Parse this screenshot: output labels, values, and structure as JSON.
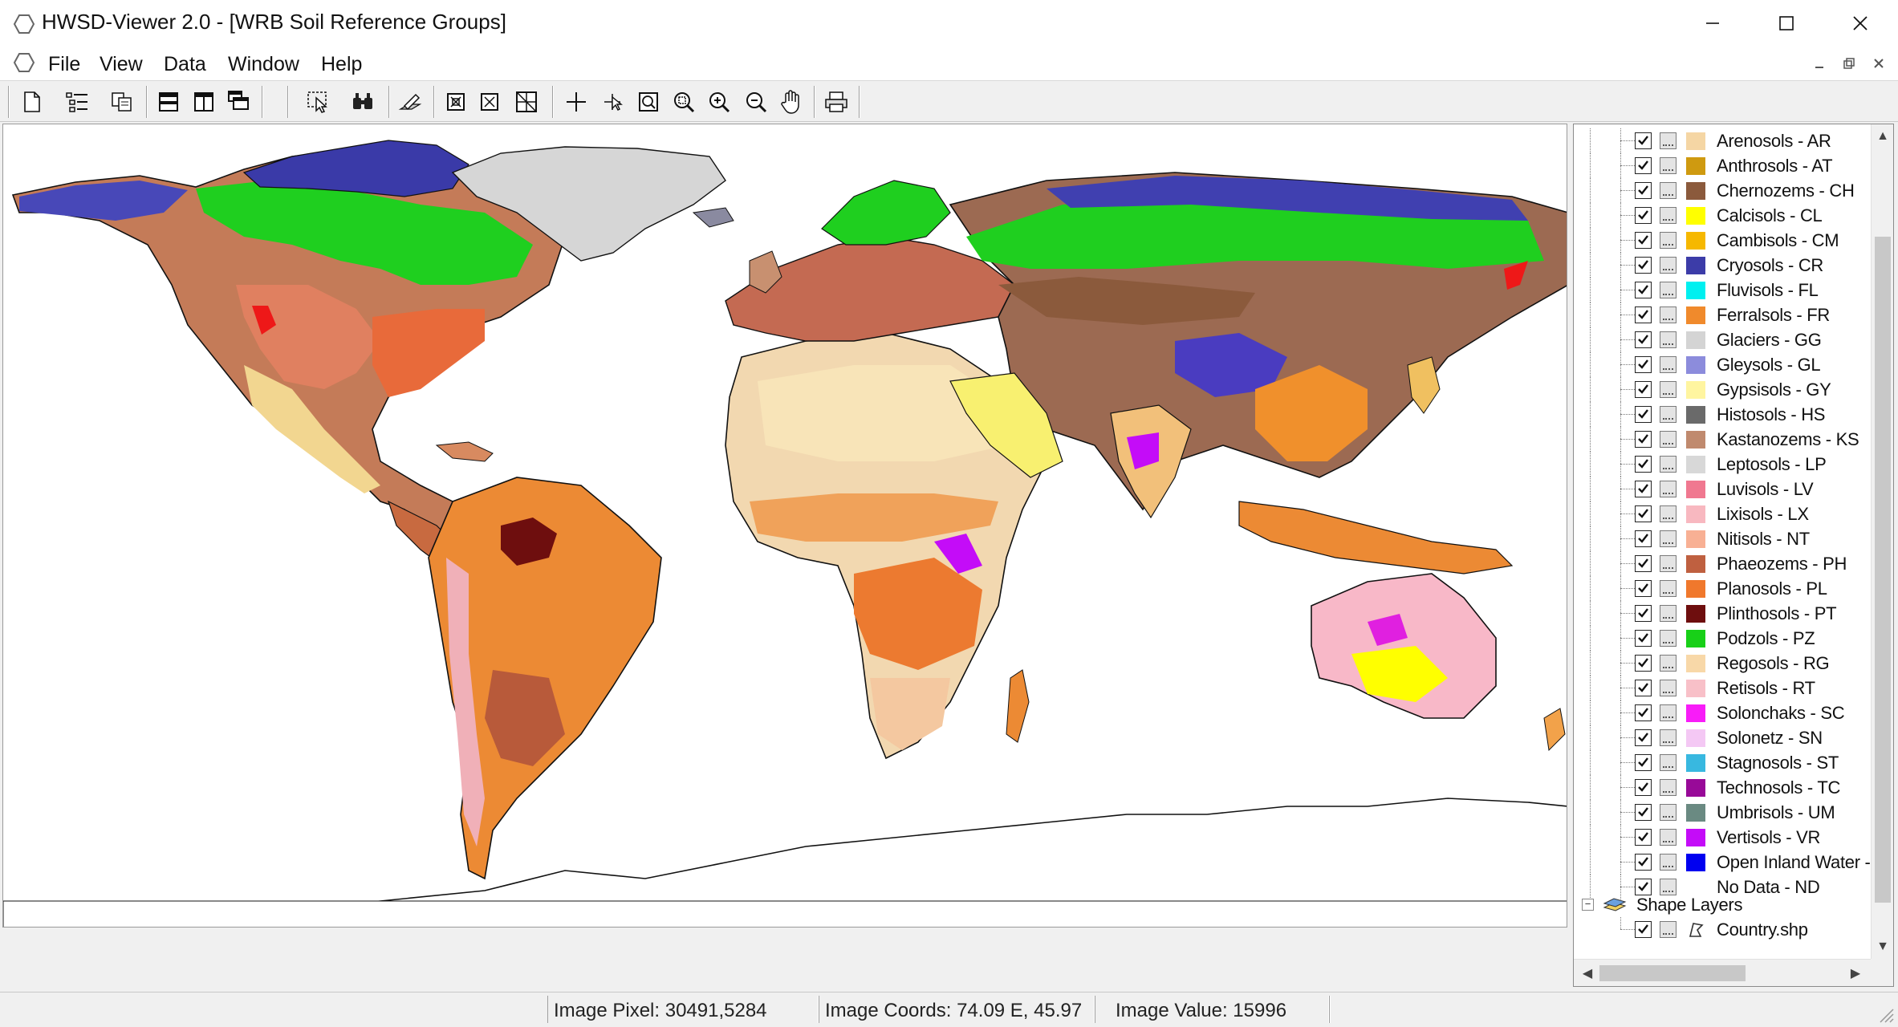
{
  "window": {
    "title": "HWSD-Viewer 2.0 - [WRB Soil Reference Groups]"
  },
  "menu": {
    "items": [
      "File",
      "View",
      "Data",
      "Window",
      "Help"
    ]
  },
  "toolbar": {
    "buttons": [
      "new-icon",
      "layer-list-icon",
      "copy-icon",
      "split-horizontal-icon",
      "split-vertical-icon",
      "cascade-icon",
      "select-icon",
      "identify-icon",
      "edit-icon",
      "zoom-box-icon",
      "zoom-prev-icon",
      "zoom-grid-icon",
      "crosshair-icon",
      "pointer-icon",
      "zoom-extent-icon",
      "zoom-region-icon",
      "zoom-in-icon",
      "zoom-out-icon",
      "pan-icon",
      "print-icon"
    ]
  },
  "legend": {
    "items": [
      {
        "label": "Arenosols - AR",
        "color": "#f5d6a4"
      },
      {
        "label": "Anthrosols - AT",
        "color": "#cf9a10"
      },
      {
        "label": "Chernozems - CH",
        "color": "#8b5a3c"
      },
      {
        "label": "Calcisols - CL",
        "color": "#ffff00"
      },
      {
        "label": "Cambisols - CM",
        "color": "#f6b800"
      },
      {
        "label": "Cryosols - CR",
        "color": "#3c3ca8"
      },
      {
        "label": "Fluvisols - FL",
        "color": "#00f0f0"
      },
      {
        "label": "Ferralsols - FR",
        "color": "#f08a2c"
      },
      {
        "label": "Glaciers - GG",
        "color": "#d4d4d4"
      },
      {
        "label": "Gleysols - GL",
        "color": "#8c8cdc"
      },
      {
        "label": "Gypsisols - GY",
        "color": "#fff5a0"
      },
      {
        "label": "Histosols - HS",
        "color": "#6a6a6a"
      },
      {
        "label": "Kastanozems - KS",
        "color": "#c08a6e"
      },
      {
        "label": "Leptosols - LP",
        "color": "#d8d8d8"
      },
      {
        "label": "Luvisols - LV",
        "color": "#f07890"
      },
      {
        "label": "Lixisols - LX",
        "color": "#f8b8c0"
      },
      {
        "label": "Nitisols - NT",
        "color": "#f8b094"
      },
      {
        "label": "Phaeozems - PH",
        "color": "#bf6040"
      },
      {
        "label": "Planosols - PL",
        "color": "#f0782c"
      },
      {
        "label": "Plinthosols - PT",
        "color": "#6e0e0e"
      },
      {
        "label": "Podzols - PZ",
        "color": "#18d018"
      },
      {
        "label": "Regosols - RG",
        "color": "#f8d8a8"
      },
      {
        "label": "Retisols - RT",
        "color": "#f8c0c8"
      },
      {
        "label": "Solonchaks - SC",
        "color": "#f81cf8"
      },
      {
        "label": "Solonetz - SN",
        "color": "#f4c8f4"
      },
      {
        "label": "Stagnosols - ST",
        "color": "#38b8e0"
      },
      {
        "label": "Technosols - TC",
        "color": "#980a98"
      },
      {
        "label": "Umbrisols - UM",
        "color": "#6a8a82"
      },
      {
        "label": "Vertisols - VR",
        "color": "#c40cf8"
      },
      {
        "label": "Open Inland Water -",
        "color": "#0000f0"
      },
      {
        "label": "No Data - ND",
        "color": "#ffffff"
      }
    ],
    "shape_layers_label": "Shape Layers",
    "shape_layer_item": "Country.shp"
  },
  "status": {
    "image_pixel": "Image Pixel: 30491,5284",
    "image_coords": "Image Coords: 74.09 E, 45.97",
    "image_value": "Image Value: 15996"
  }
}
